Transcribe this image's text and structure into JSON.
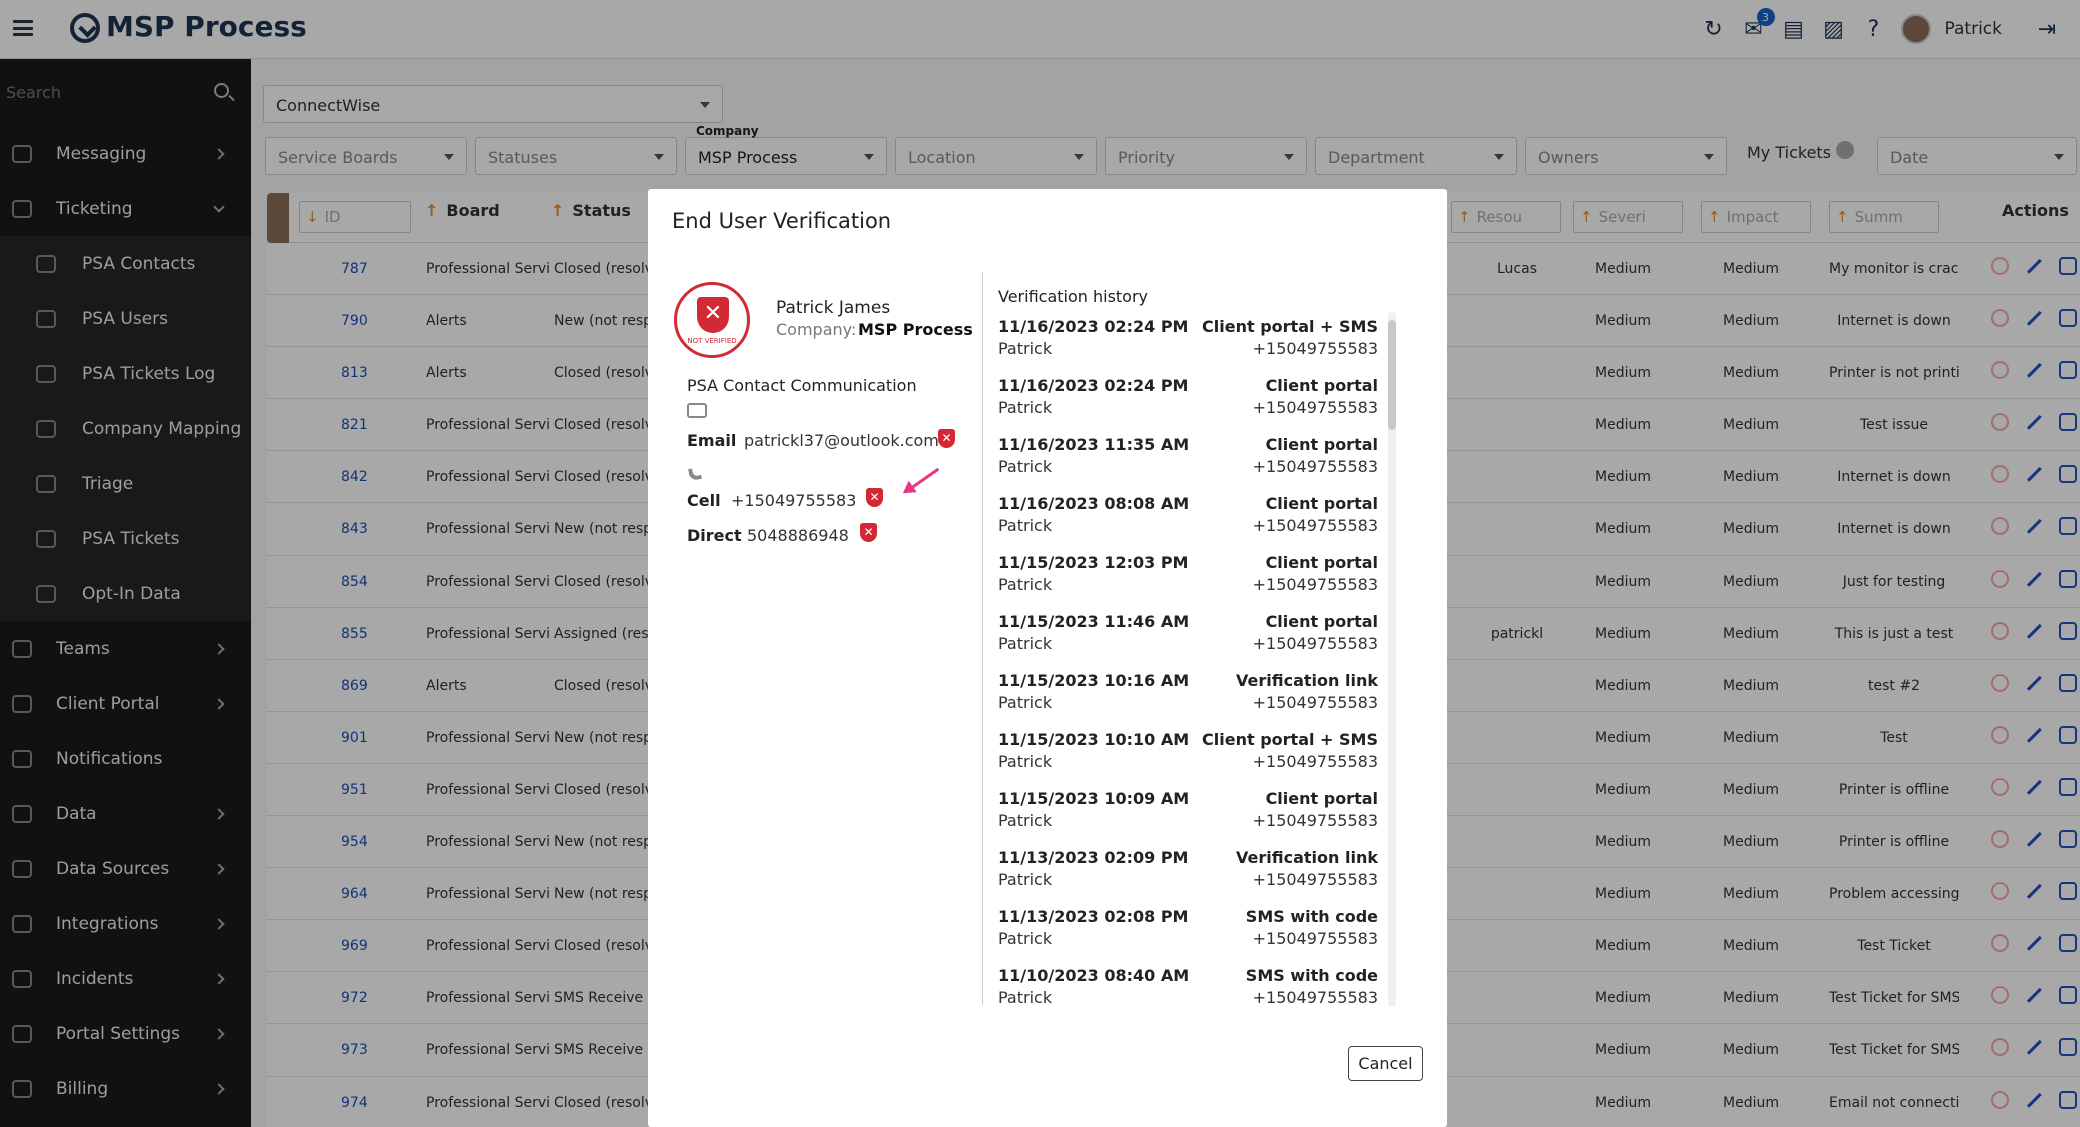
{
  "app": {
    "title": "MSP Process",
    "user": "Patrick",
    "mail_badge": "3"
  },
  "sidebar": {
    "search_placeholder": "Search",
    "items": [
      {
        "label": "Messaging",
        "icon": "message-icon",
        "chevron": true,
        "sub": false
      },
      {
        "label": "Ticketing",
        "icon": "ticket-icon",
        "chevron": true,
        "sub": false,
        "expanded": true
      },
      {
        "label": "PSA Contacts",
        "icon": "person-icon",
        "sub": true
      },
      {
        "label": "PSA Users",
        "icon": "person-icon",
        "sub": true
      },
      {
        "label": "PSA Tickets Log",
        "icon": "ticket-icon",
        "sub": true
      },
      {
        "label": "Company Mapping",
        "icon": "map-icon",
        "sub": true
      },
      {
        "label": "Triage",
        "icon": "triage-icon",
        "sub": true
      },
      {
        "label": "PSA Tickets",
        "icon": "ticket-icon",
        "sub": true
      },
      {
        "label": "Opt-In Data",
        "icon": "optin-icon",
        "sub": true
      },
      {
        "label": "Teams",
        "icon": "teams-icon",
        "chevron": true,
        "sub": false
      },
      {
        "label": "Client Portal",
        "icon": "portal-icon",
        "chevron": true,
        "sub": false
      },
      {
        "label": "Notifications",
        "icon": "bell-icon",
        "chevron": false,
        "sub": false
      },
      {
        "label": "Data",
        "icon": "data-icon",
        "chevron": true,
        "sub": false
      },
      {
        "label": "Data Sources",
        "icon": "database-icon",
        "chevron": true,
        "sub": false
      },
      {
        "label": "Integrations",
        "icon": "integrations-icon",
        "chevron": true,
        "sub": false
      },
      {
        "label": "Incidents",
        "icon": "alarm-icon",
        "chevron": true,
        "sub": false
      },
      {
        "label": "Portal Settings",
        "icon": "gear-icon",
        "chevron": true,
        "sub": false
      },
      {
        "label": "Billing",
        "icon": "billing-icon",
        "chevron": true,
        "sub": false
      }
    ]
  },
  "filters": {
    "psa": "ConnectWise",
    "service_boards": "Service Boards",
    "statuses": "Statuses",
    "company_label": "Company",
    "company": "MSP Process",
    "location": "Location",
    "priority": "Priority",
    "department": "Department",
    "owners": "Owners",
    "my_tickets": "My Tickets",
    "date": "Date"
  },
  "table": {
    "headers": {
      "id": "ID",
      "board": "Board",
      "status": "Status",
      "resource": "Resou",
      "severity": "Severi",
      "impact": "Impact",
      "summary": "Summ",
      "actions": "Actions"
    },
    "rows": [
      {
        "id": "787",
        "board": "Professional Servic",
        "status": "Closed (resolve",
        "resource": "Lucas",
        "severity": "Medium",
        "impact": "Medium",
        "summary": "My monitor is crack"
      },
      {
        "id": "790",
        "board": "Alerts",
        "status": "New (not resp",
        "resource": "",
        "severity": "Medium",
        "impact": "Medium",
        "summary": "Internet is down"
      },
      {
        "id": "813",
        "board": "Alerts",
        "status": "Closed (resolve",
        "resource": "",
        "severity": "Medium",
        "impact": "Medium",
        "summary": "Printer is not printi"
      },
      {
        "id": "821",
        "board": "Professional Servic",
        "status": "Closed (resolve",
        "resource": "",
        "severity": "Medium",
        "impact": "Medium",
        "summary": "Test issue"
      },
      {
        "id": "842",
        "board": "Professional Servic",
        "status": "Closed (resolve",
        "resource": "",
        "severity": "Medium",
        "impact": "Medium",
        "summary": "Internet is down"
      },
      {
        "id": "843",
        "board": "Professional Servic",
        "status": "New (not respo",
        "resource": "",
        "severity": "Medium",
        "impact": "Medium",
        "summary": "Internet is down"
      },
      {
        "id": "854",
        "board": "Professional Servic",
        "status": "Closed (resolve",
        "resource": "",
        "severity": "Medium",
        "impact": "Medium",
        "summary": "Just for testing"
      },
      {
        "id": "855",
        "board": "Professional Servic",
        "status": "Assigned (resp",
        "resource": "patrickl",
        "severity": "Medium",
        "impact": "Medium",
        "summary": "This is just a test"
      },
      {
        "id": "869",
        "board": "Alerts",
        "status": "Closed (resolve",
        "resource": "",
        "severity": "Medium",
        "impact": "Medium",
        "summary": "test #2"
      },
      {
        "id": "901",
        "board": "Professional Servic",
        "status": "New (not respo",
        "resource": "",
        "severity": "Medium",
        "impact": "Medium",
        "summary": "Test"
      },
      {
        "id": "951",
        "board": "Professional Servic",
        "status": "Closed (resolve",
        "resource": "",
        "severity": "Medium",
        "impact": "Medium",
        "summary": "Printer is offline"
      },
      {
        "id": "954",
        "board": "Professional Servic",
        "status": "New (not respo",
        "resource": "",
        "severity": "Medium",
        "impact": "Medium",
        "summary": "Printer is offline"
      },
      {
        "id": "964",
        "board": "Professional Servic",
        "status": "New (not respo",
        "resource": "",
        "severity": "Medium",
        "impact": "Medium",
        "summary": "Problem accessing"
      },
      {
        "id": "969",
        "board": "Professional Servic",
        "status": "Closed (resolve",
        "resource": "",
        "severity": "Medium",
        "impact": "Medium",
        "summary": "Test Ticket"
      },
      {
        "id": "972",
        "board": "Professional Servic",
        "status": "SMS Receive",
        "resource": "",
        "severity": "Medium",
        "impact": "Medium",
        "summary": "Test Ticket for SMS"
      },
      {
        "id": "973",
        "board": "Professional Servic",
        "status": "SMS Receive",
        "resource": "",
        "severity": "Medium",
        "impact": "Medium",
        "summary": "Test Ticket for SMS"
      },
      {
        "id": "974",
        "board": "Professional Servic",
        "status": "Closed (resolve",
        "resource": "",
        "severity": "Medium",
        "impact": "Medium",
        "summary": "Email not connectir"
      }
    ]
  },
  "modal": {
    "title": "End User Verification",
    "badge_text": "NOT VERIFIED",
    "name": "Patrick James",
    "company_label": "Company:",
    "company": "MSP Process",
    "comm_title": "PSA Contact Communication",
    "email_label": "Email",
    "email": "patrickl37@outlook.com",
    "cell_label": "Cell",
    "cell": "+15049755583",
    "direct_label": "Direct",
    "direct": "5048886948",
    "history_title": "Verification history",
    "history": [
      {
        "date": "11/16/2023 02:24 PM",
        "user": "Patrick",
        "method": "Client portal + SMS",
        "phone": "+15049755583"
      },
      {
        "date": "11/16/2023 02:24 PM",
        "user": "Patrick",
        "method": "Client portal",
        "phone": "+15049755583"
      },
      {
        "date": "11/16/2023 11:35 AM",
        "user": "Patrick",
        "method": "Client portal",
        "phone": "+15049755583"
      },
      {
        "date": "11/16/2023 08:08 AM",
        "user": "Patrick",
        "method": "Client portal",
        "phone": "+15049755583"
      },
      {
        "date": "11/15/2023 12:03 PM",
        "user": "Patrick",
        "method": "Client portal",
        "phone": "+15049755583"
      },
      {
        "date": "11/15/2023 11:46 AM",
        "user": "Patrick",
        "method": "Client portal",
        "phone": "+15049755583"
      },
      {
        "date": "11/15/2023 10:16 AM",
        "user": "Patrick",
        "method": "Verification link",
        "phone": "+15049755583"
      },
      {
        "date": "11/15/2023 10:10 AM",
        "user": "Patrick",
        "method": "Client portal + SMS",
        "phone": "+15049755583"
      },
      {
        "date": "11/15/2023 10:09 AM",
        "user": "Patrick",
        "method": "Client portal",
        "phone": "+15049755583"
      },
      {
        "date": "11/13/2023 02:09 PM",
        "user": "Patrick",
        "method": "Verification link",
        "phone": "+15049755583"
      },
      {
        "date": "11/13/2023 02:08 PM",
        "user": "Patrick",
        "method": "SMS with code",
        "phone": "+15049755583"
      },
      {
        "date": "11/10/2023 08:40 AM",
        "user": "Patrick",
        "method": "SMS with code",
        "phone": "+15049755583"
      }
    ],
    "cancel_label": "Cancel"
  }
}
